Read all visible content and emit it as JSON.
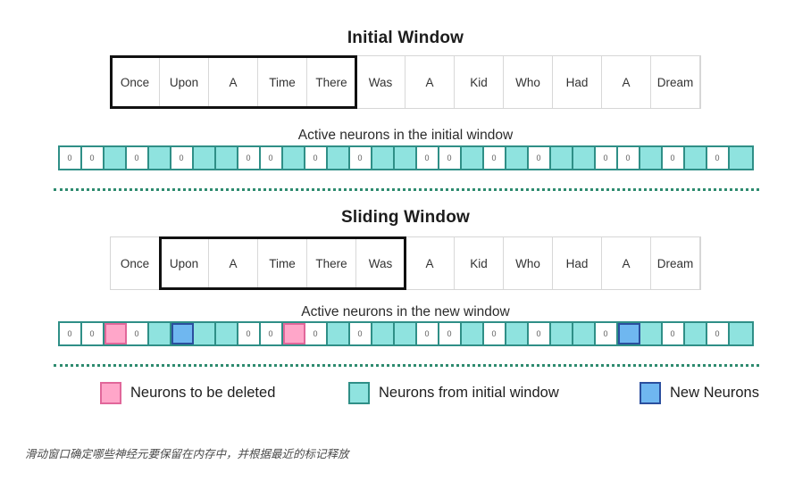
{
  "initial_section": {
    "title": "Initial Window",
    "tokens": [
      "Once",
      "Upon",
      "A",
      "Time",
      "There",
      "Was",
      "A",
      "Kid",
      "Who",
      "Had",
      "A",
      "Dream"
    ],
    "highlight_start_index": 0,
    "highlight_end_index": 4,
    "strip_caption": "Active neurons in the initial window",
    "zero_label": "0",
    "neurons": [
      "zero",
      "zero",
      "cyan",
      "zero",
      "cyan",
      "zero",
      "cyan",
      "cyan",
      "zero",
      "zero",
      "cyan",
      "zero",
      "cyan",
      "zero",
      "cyan",
      "cyan",
      "zero",
      "zero",
      "cyan",
      "zero",
      "cyan",
      "zero",
      "cyan",
      "cyan",
      "zero",
      "zero",
      "cyan",
      "zero",
      "cyan",
      "zero",
      "cyan"
    ]
  },
  "sliding_section": {
    "title": "Sliding Window",
    "tokens": [
      "Once",
      "Upon",
      "A",
      "Time",
      "There",
      "Was",
      "A",
      "Kid",
      "Who",
      "Had",
      "A",
      "Dream"
    ],
    "highlight_start_index": 1,
    "highlight_end_index": 5,
    "strip_caption": "Active neurons in the new window",
    "zero_label": "0",
    "neurons": [
      "zero",
      "zero",
      "pink",
      "zero",
      "cyan",
      "blue",
      "cyan",
      "cyan",
      "zero",
      "zero",
      "pink",
      "zero",
      "cyan",
      "zero",
      "cyan",
      "cyan",
      "zero",
      "zero",
      "cyan",
      "zero",
      "cyan",
      "zero",
      "cyan",
      "cyan",
      "zero",
      "blue",
      "cyan",
      "zero",
      "cyan",
      "zero",
      "cyan"
    ]
  },
  "legend": {
    "items": [
      {
        "swatch": "pink",
        "label": "Neurons to be deleted"
      },
      {
        "swatch": "cyan",
        "label": "Neurons from initial window"
      },
      {
        "swatch": "blue",
        "label": "New Neurons"
      }
    ]
  },
  "figure_caption": "滑动窗口确定哪些神经元要保留在内存中，并根据最近的标记释放",
  "colors": {
    "pink_fill": "#ffa6c9",
    "pink_border": "#e1679a",
    "cyan_fill": "#8fe3df",
    "cyan_border": "#2f8f87",
    "blue_fill": "#6fb7f0",
    "blue_border": "#2b4f9e",
    "divider": "#2e8b6f",
    "highlight_border": "#111111"
  }
}
